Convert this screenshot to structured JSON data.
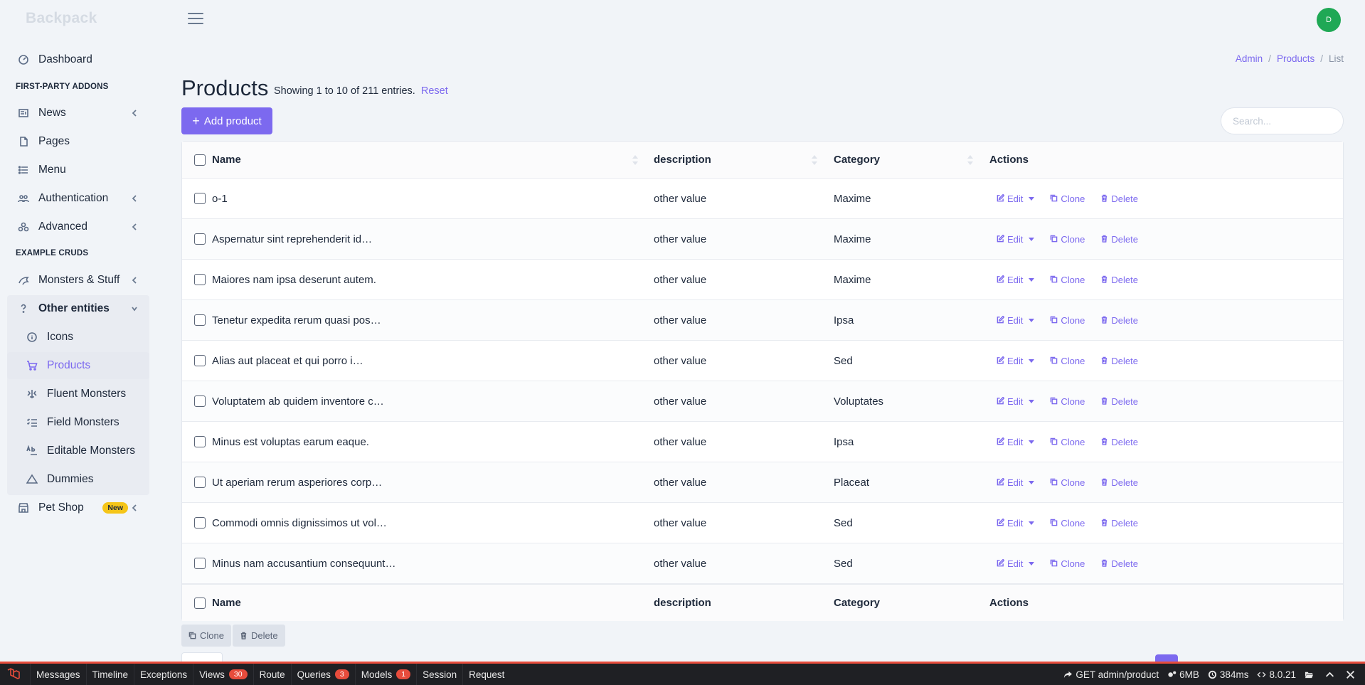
{
  "brand": "Backpack",
  "user": {
    "avatar_initial": "D"
  },
  "sidebar": {
    "dashboard": "Dashboard",
    "section_first_party": "FIRST-PARTY ADDONS",
    "news": "News",
    "pages": "Pages",
    "menu": "Menu",
    "authentication": "Authentication",
    "advanced": "Advanced",
    "section_example": "EXAMPLE CRUDS",
    "monsters_stuff": "Monsters & Stuff",
    "other_entities": "Other entities",
    "icons": "Icons",
    "products": "Products",
    "fluent_monsters": "Fluent Monsters",
    "field_monsters": "Field Monsters",
    "editable_monsters": "Editable Monsters",
    "dummies": "Dummies",
    "pet_shop": "Pet Shop",
    "pet_shop_badge": "New"
  },
  "breadcrumb": {
    "admin": "Admin",
    "products": "Products",
    "list": "List"
  },
  "page": {
    "title": "Products",
    "subtitle": "Showing 1 to 10 of 211 entries.",
    "reset": "Reset",
    "add_button": "Add product",
    "search_placeholder": "Search..."
  },
  "table": {
    "headers": {
      "name": "Name",
      "description": "description",
      "category": "Category",
      "actions": "Actions"
    },
    "actions": {
      "edit": "Edit",
      "clone": "Clone",
      "delete": "Delete"
    },
    "rows": [
      {
        "name": "o-1",
        "description": "other value",
        "category": "Maxime"
      },
      {
        "name": "Aspernatur sint reprehenderit id…",
        "description": "other value",
        "category": "Maxime"
      },
      {
        "name": "Maiores nam ipsa deserunt autem.",
        "description": "other value",
        "category": "Maxime"
      },
      {
        "name": "Tenetur expedita rerum quasi pos…",
        "description": "other value",
        "category": "Ipsa"
      },
      {
        "name": "Alias aut placeat et qui porro i…",
        "description": "other value",
        "category": "Sed"
      },
      {
        "name": "Voluptatem ab quidem inventore c…",
        "description": "other value",
        "category": "Voluptates"
      },
      {
        "name": "Minus est voluptas earum eaque.",
        "description": "other value",
        "category": "Ipsa"
      },
      {
        "name": "Ut aperiam rerum asperiores corp…",
        "description": "other value",
        "category": "Placeat"
      },
      {
        "name": "Commodi omnis dignissimos ut vol…",
        "description": "other value",
        "category": "Sed"
      },
      {
        "name": "Minus nam accusantium consequunt…",
        "description": "other value",
        "category": "Sed"
      }
    ]
  },
  "bulk": {
    "clone": "Clone",
    "delete": "Delete"
  },
  "debugbar": {
    "messages": "Messages",
    "timeline": "Timeline",
    "exceptions": "Exceptions",
    "views": "Views",
    "views_count": "30",
    "route": "Route",
    "queries": "Queries",
    "queries_count": "3",
    "models": "Models",
    "models_count": "1",
    "session": "Session",
    "request": "Request",
    "route_info": "GET admin/product",
    "memory": "6MB",
    "time": "384ms",
    "php_version": "8.0.21"
  },
  "colors": {
    "accent": "#7c69ef",
    "avatar": "#1fa855",
    "debug_red": "#e74c3c"
  }
}
